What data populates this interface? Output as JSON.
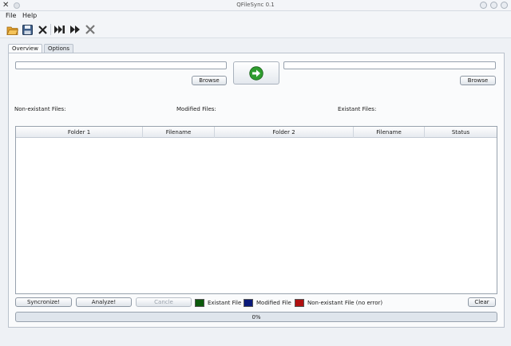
{
  "window": {
    "title": "QFileSync 0.1"
  },
  "menu": {
    "file": "File",
    "help": "Help"
  },
  "toolbar": {
    "items": [
      "open-folder-icon",
      "save-icon",
      "close-icon",
      "skip-forward-icon",
      "fast-forward-icon",
      "disabled-tool-icon"
    ]
  },
  "tabs": [
    {
      "label": "Overview",
      "active": true
    },
    {
      "label": "Options",
      "active": false
    }
  ],
  "folders": {
    "left_path": "",
    "right_path": "",
    "browse_label": "Browse"
  },
  "stats": {
    "non_existant": "Non-existant Files:",
    "modified": "Modified Files:",
    "existant": "Existant Files:"
  },
  "table": {
    "columns": [
      "Folder 1",
      "Filename",
      "Folder 2",
      "Filename",
      "Status"
    ],
    "rows": []
  },
  "actions": {
    "syncronize": "Syncronize!",
    "analyze": "Analyze!",
    "cancel": "Cancle",
    "clear": "Clear"
  },
  "legend": [
    {
      "label": "Existant File",
      "color": "#0b5a0b"
    },
    {
      "label": "Modified File",
      "color": "#0a1a7a"
    },
    {
      "label": "Non-existant File (no error)",
      "color": "#b01010"
    }
  ],
  "progress": {
    "value": 0,
    "text": "0%"
  },
  "colors": {
    "go_arrow": "#2e9c2e"
  }
}
